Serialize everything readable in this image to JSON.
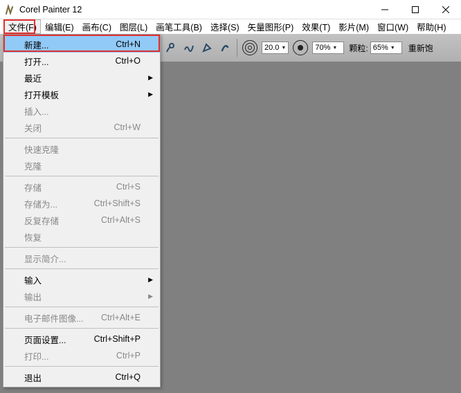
{
  "title": "Corel Painter 12",
  "menubar": [
    "文件(F)",
    "编辑(E)",
    "画布(C)",
    "图层(L)",
    "画笔工具(B)",
    "选择(S)",
    "矢量图形(P)",
    "效果(T)",
    "影片(M)",
    "窗口(W)",
    "帮助(H)"
  ],
  "toolbar": {
    "size_value": "20.0",
    "opacity_value": "70%",
    "grain_label": "颗粒:",
    "grain_value": "65%",
    "refill_label": "重新饱"
  },
  "file_menu": [
    {
      "label": "新建...",
      "shortcut": "Ctrl+N",
      "highlight": true
    },
    {
      "label": "打开...",
      "shortcut": "Ctrl+O"
    },
    {
      "label": "最近",
      "submenu": true
    },
    {
      "label": "打开模板",
      "submenu": true
    },
    {
      "label": "插入...",
      "disabled": true
    },
    {
      "label": "关闭",
      "shortcut": "Ctrl+W",
      "disabled": true
    },
    {
      "sep": true
    },
    {
      "label": "快速克隆",
      "disabled": true
    },
    {
      "label": "克隆",
      "disabled": true
    },
    {
      "sep": true
    },
    {
      "label": "存储",
      "shortcut": "Ctrl+S",
      "disabled": true
    },
    {
      "label": "存储为...",
      "shortcut": "Ctrl+Shift+S",
      "disabled": true
    },
    {
      "label": "反复存储",
      "shortcut": "Ctrl+Alt+S",
      "disabled": true
    },
    {
      "label": "恢复",
      "disabled": true
    },
    {
      "sep": true
    },
    {
      "label": "显示简介...",
      "disabled": true
    },
    {
      "sep": true
    },
    {
      "label": "输入",
      "submenu": true
    },
    {
      "label": "输出",
      "submenu": true,
      "disabled": true
    },
    {
      "sep": true
    },
    {
      "label": "电子邮件图像...",
      "shortcut": "Ctrl+Alt+E",
      "disabled": true
    },
    {
      "sep": true
    },
    {
      "label": "页面设置...",
      "shortcut": "Ctrl+Shift+P"
    },
    {
      "label": "打印...",
      "shortcut": "Ctrl+P",
      "disabled": true
    },
    {
      "sep": true
    },
    {
      "label": "退出",
      "shortcut": "Ctrl+Q"
    }
  ]
}
